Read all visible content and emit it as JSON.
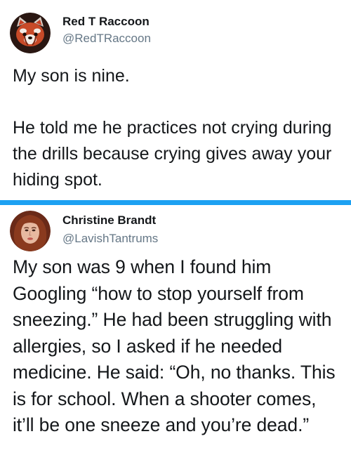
{
  "tweets": [
    {
      "display_name": "Red T Raccoon",
      "handle": "@RedTRaccoon",
      "text": "My son is nine.\n\nHe told me he practices not crying during the drills because crying gives away your hiding spot.",
      "avatar_icon": "red-panda-avatar"
    },
    {
      "display_name": "Christine Brandt",
      "handle": "@LavishTantrums",
      "text": "My son was 9 when I found him Googling “how to stop yourself from sneezing.” He had been struggling with allergies, so I asked if he needed medicine. He said: “Oh, no thanks. This is for school. When a shooter comes, it’ll be one sneeze and you’re dead.”",
      "avatar_icon": "profile-photo-avatar"
    }
  ],
  "colors": {
    "divider": "#1da1f2",
    "handle": "#657786",
    "text": "#14171a"
  }
}
